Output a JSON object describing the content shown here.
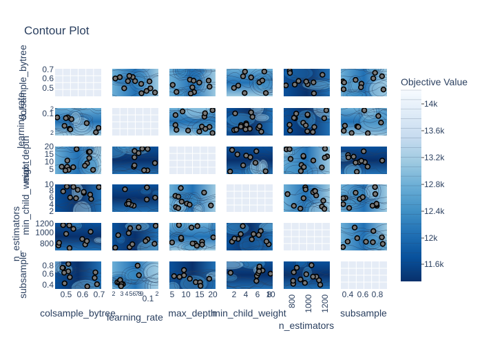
{
  "chart_data": {
    "type": "contour",
    "title": "Contour Plot",
    "params": [
      "colsample_bytree",
      "learning_rate",
      "max_depth",
      "min_child_weight",
      "n_estimators",
      "subsample"
    ],
    "x_ticks": {
      "colsample_bytree": [
        "0.5",
        "0.6",
        "0.7"
      ],
      "learning_rate": [
        "2",
        "3",
        "4",
        "5",
        "6",
        "7",
        "8",
        "9",
        "0.1",
        "2"
      ],
      "max_depth": [
        "5",
        "10",
        "15",
        "20"
      ],
      "min_child_weight": [
        "2",
        "4",
        "6",
        "8",
        "10"
      ],
      "n_estimators": [
        "800",
        "1000",
        "1200"
      ],
      "subsample": [
        "0.4",
        "0.6",
        "0.8"
      ]
    },
    "y_ticks": {
      "colsample_bytree": [
        "0.7",
        "0.6",
        "0.5"
      ],
      "learning_rate": [
        "0.1",
        "2",
        "2"
      ],
      "max_depth": [
        "20",
        "15",
        "10",
        "5"
      ],
      "min_child_weight": [
        "10",
        "8",
        "6",
        "4",
        "2"
      ],
      "n_estimators": [
        "1200",
        "1000",
        "800"
      ],
      "subsample": [
        "0.8",
        "0.6",
        "0.4"
      ]
    },
    "colorbar": {
      "title": "Objective Value",
      "ticks": [
        "14k",
        "13.6k",
        "13.2k",
        "12.8k",
        "12.4k",
        "12k",
        "11.6k"
      ],
      "colorscale": [
        "#f7fbff",
        "#deebf7",
        "#c6dbef",
        "#9ecae1",
        "#6baed6",
        "#4292c6",
        "#2171b5",
        "#08519c",
        "#08306b"
      ]
    }
  }
}
